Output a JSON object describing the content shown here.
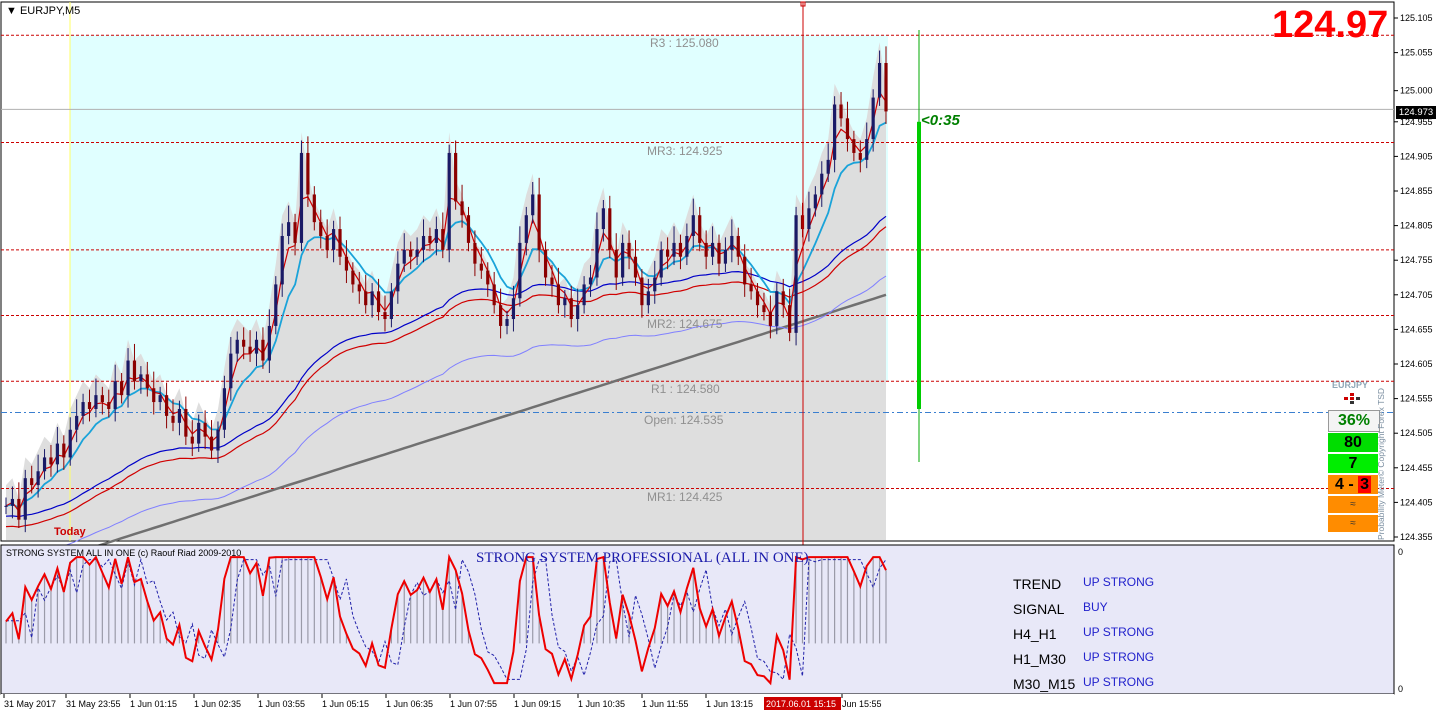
{
  "window": {
    "symbol_label": "EURJPY,M5",
    "big_price": "124.97",
    "current_price_tag": "124.973",
    "timer_label": "<0:35"
  },
  "colors": {
    "big_price": "#ff0000",
    "level_line": "#c00000",
    "ema_fast": "#1aa3d9",
    "ema_mid_red": "#d00000",
    "ema_mid_blue": "#0000c8",
    "ema_slow_purple": "#8080ff",
    "ema_long_gray": "#707070",
    "fill_upper": "#e0ffff",
    "fill_lower": "#dcdcdc",
    "bull_candle": "#1a1a66",
    "bear_candle": "#8b0000",
    "timer_bar": "#00cc00",
    "timer_text": "#008000"
  },
  "chart_data": [
    {
      "type": "candlestick",
      "symbol": "EURJPY",
      "timeframe": "M5",
      "y_ticks": [
        "125.105",
        "125.055",
        "125.000",
        "124.955",
        "124.905",
        "124.855",
        "124.805",
        "124.755",
        "124.705",
        "124.655",
        "124.605",
        "124.555",
        "124.505",
        "124.455",
        "124.405",
        "124.355"
      ],
      "ylim": [
        124.355,
        125.105
      ],
      "pivot_levels": [
        {
          "label": "R3 : 125.080",
          "value": 125.08
        },
        {
          "label": "MR3: 124.925",
          "value": 124.925
        },
        {
          "label": "",
          "value": 124.77
        },
        {
          "label": "MR2: 124.675",
          "value": 124.675
        },
        {
          "label": "R1 : 124.580",
          "value": 124.58
        },
        {
          "label": "Open: 124.535",
          "value": 124.535
        },
        {
          "label": "MR1: 124.425",
          "value": 124.425
        }
      ],
      "today_label": "Today",
      "last_price": 124.973,
      "x_tick_labels": [
        "31 May 2017",
        "31 May 23:55",
        "1 Jun 01:15",
        "1 Jun 02:35",
        "1 Jun 03:55",
        "1 Jun 05:15",
        "1 Jun 06:35",
        "1 Jun 07:55",
        "1 Jun 09:15",
        "1 Jun 10:35",
        "1 Jun 11:55",
        "1 Jun 13:15",
        "2017.06.01 15:15",
        "Jun 15:55"
      ],
      "ohlc_close": [
        124.4,
        124.41,
        124.38,
        124.44,
        124.43,
        124.45,
        124.47,
        124.46,
        124.49,
        124.47,
        124.51,
        124.53,
        124.55,
        124.54,
        124.56,
        124.55,
        124.54,
        124.58,
        124.56,
        124.61,
        124.58,
        124.59,
        124.57,
        124.55,
        124.56,
        124.53,
        124.52,
        124.54,
        124.5,
        124.49,
        124.52,
        124.5,
        124.48,
        124.51,
        124.57,
        124.62,
        124.64,
        124.63,
        124.62,
        124.64,
        124.61,
        124.66,
        124.72,
        124.79,
        124.81,
        124.78,
        124.91,
        124.85,
        124.81,
        124.79,
        124.77,
        124.8,
        124.76,
        124.74,
        124.72,
        124.71,
        124.69,
        124.71,
        124.68,
        124.67,
        124.71,
        124.75,
        124.77,
        124.76,
        124.77,
        124.79,
        124.78,
        124.8,
        124.77,
        124.91,
        124.84,
        124.82,
        124.78,
        124.75,
        124.74,
        124.72,
        124.69,
        124.66,
        124.67,
        124.7,
        124.78,
        124.82,
        124.85,
        124.77,
        124.73,
        124.72,
        124.69,
        124.7,
        124.67,
        124.69,
        124.72,
        124.73,
        124.8,
        124.83,
        124.77,
        124.73,
        124.78,
        124.76,
        124.73,
        124.69,
        124.71,
        124.73,
        124.77,
        124.76,
        124.78,
        124.76,
        124.79,
        124.82,
        124.78,
        124.76,
        124.78,
        124.75,
        124.77,
        124.79,
        124.76,
        124.72,
        124.71,
        124.69,
        124.68,
        124.66,
        124.71,
        124.69,
        124.65,
        124.82,
        124.8,
        124.83,
        124.85,
        124.88,
        124.9,
        124.98,
        124.96,
        124.93,
        124.91,
        124.9,
        124.93,
        124.99,
        125.04,
        124.97
      ],
      "indicator": {
        "title": "STRONG SYSTEM ALL IN ONE (c) Raouf Riad 2009-2010",
        "center_title": "STRONG SYSTEM PROFESSIONAL (ALL IN ONE)",
        "scale_top": "0",
        "scale_bottom": "0",
        "rows": [
          {
            "label": "TREND",
            "value": "UP STRONG"
          },
          {
            "label": "SIGNAL",
            "value": "BUY"
          },
          {
            "label": "H4_H1",
            "value": "UP STRONG"
          },
          {
            "label": "H1_M30",
            "value": "UP STRONG"
          },
          {
            "label": "M30_M15",
            "value": "UP STRONG"
          }
        ]
      }
    }
  ],
  "meter": {
    "symbol": "EURJPY",
    "percent": "36%",
    "box1": "80",
    "box2": "7",
    "box3_left": "4",
    "box3_right": "3",
    "vertical_label": "Probability Meter© Copyright Forex TSD"
  }
}
